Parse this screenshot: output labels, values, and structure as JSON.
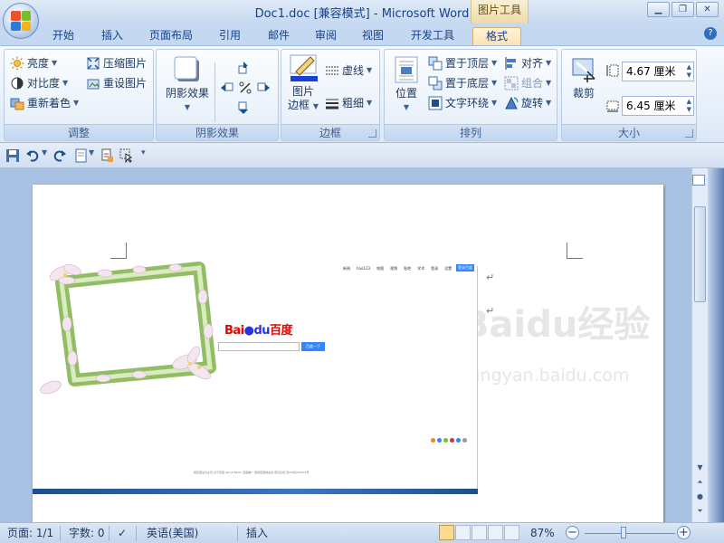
{
  "window": {
    "title": "Doc1.doc [兼容模式] - Microsoft Word",
    "context_tools": "图片工具",
    "controls": [
      "minimize",
      "restore",
      "close"
    ]
  },
  "tabs": [
    {
      "label": "开始",
      "active": false
    },
    {
      "label": "插入",
      "active": false
    },
    {
      "label": "页面布局",
      "active": false
    },
    {
      "label": "引用",
      "active": false
    },
    {
      "label": "邮件",
      "active": false
    },
    {
      "label": "审阅",
      "active": false
    },
    {
      "label": "视图",
      "active": false
    },
    {
      "label": "开发工具",
      "active": false
    },
    {
      "label": "格式",
      "active": true
    }
  ],
  "ribbon": {
    "adjust": {
      "label": "调整",
      "brightness": "亮度",
      "contrast": "对比度",
      "recolor": "重新着色",
      "compress": "压缩图片",
      "reset": "重设图片"
    },
    "shadow": {
      "label": "阴影效果",
      "shadow_effects": "阴影效果"
    },
    "border": {
      "label": "边框",
      "picture_border_line1": "图片",
      "picture_border_line2": "边框",
      "dashes": "虚线",
      "weight": "粗细"
    },
    "arrange": {
      "label": "排列",
      "position": "位置",
      "bring_front": "置于顶层",
      "send_back": "置于底层",
      "text_wrap": "文字环绕",
      "align": "对齐",
      "group": "组合",
      "rotate": "旋转"
    },
    "size": {
      "label": "大小",
      "crop": "裁剪",
      "height": "4.67 厘米",
      "width": "6.45 厘米"
    }
  },
  "document": {
    "baidu_nav": [
      "新闻",
      "hao123",
      "地图",
      "视频",
      "贴吧",
      "学术",
      "登录",
      "设置",
      "更多产品"
    ],
    "baidu_nav_button": "登录百度",
    "baidu_logo_left": "Bai",
    "baidu_logo_du": "du",
    "baidu_logo_right": "百度",
    "baidu_search_button": "百度一下",
    "baidu_footer": "把百度设为主页 关于百度 About Baidu 百度推广 使用百度前必读 意见反馈 京ICP证030173号",
    "watermark": "Baidu经验",
    "watermark_url": "jingyan.baidu.com",
    "paragraph_mark": "↵"
  },
  "status": {
    "page": "页面: 1/1",
    "words": "字数: 0",
    "language": "英语(美国)",
    "mode": "插入",
    "zoom": "87%",
    "zoom_value": 87
  },
  "colors": {
    "accent": "#15428b",
    "baidu_red": "#e10601",
    "baidu_blue": "#2932e1",
    "search_blue": "#3385ff"
  }
}
